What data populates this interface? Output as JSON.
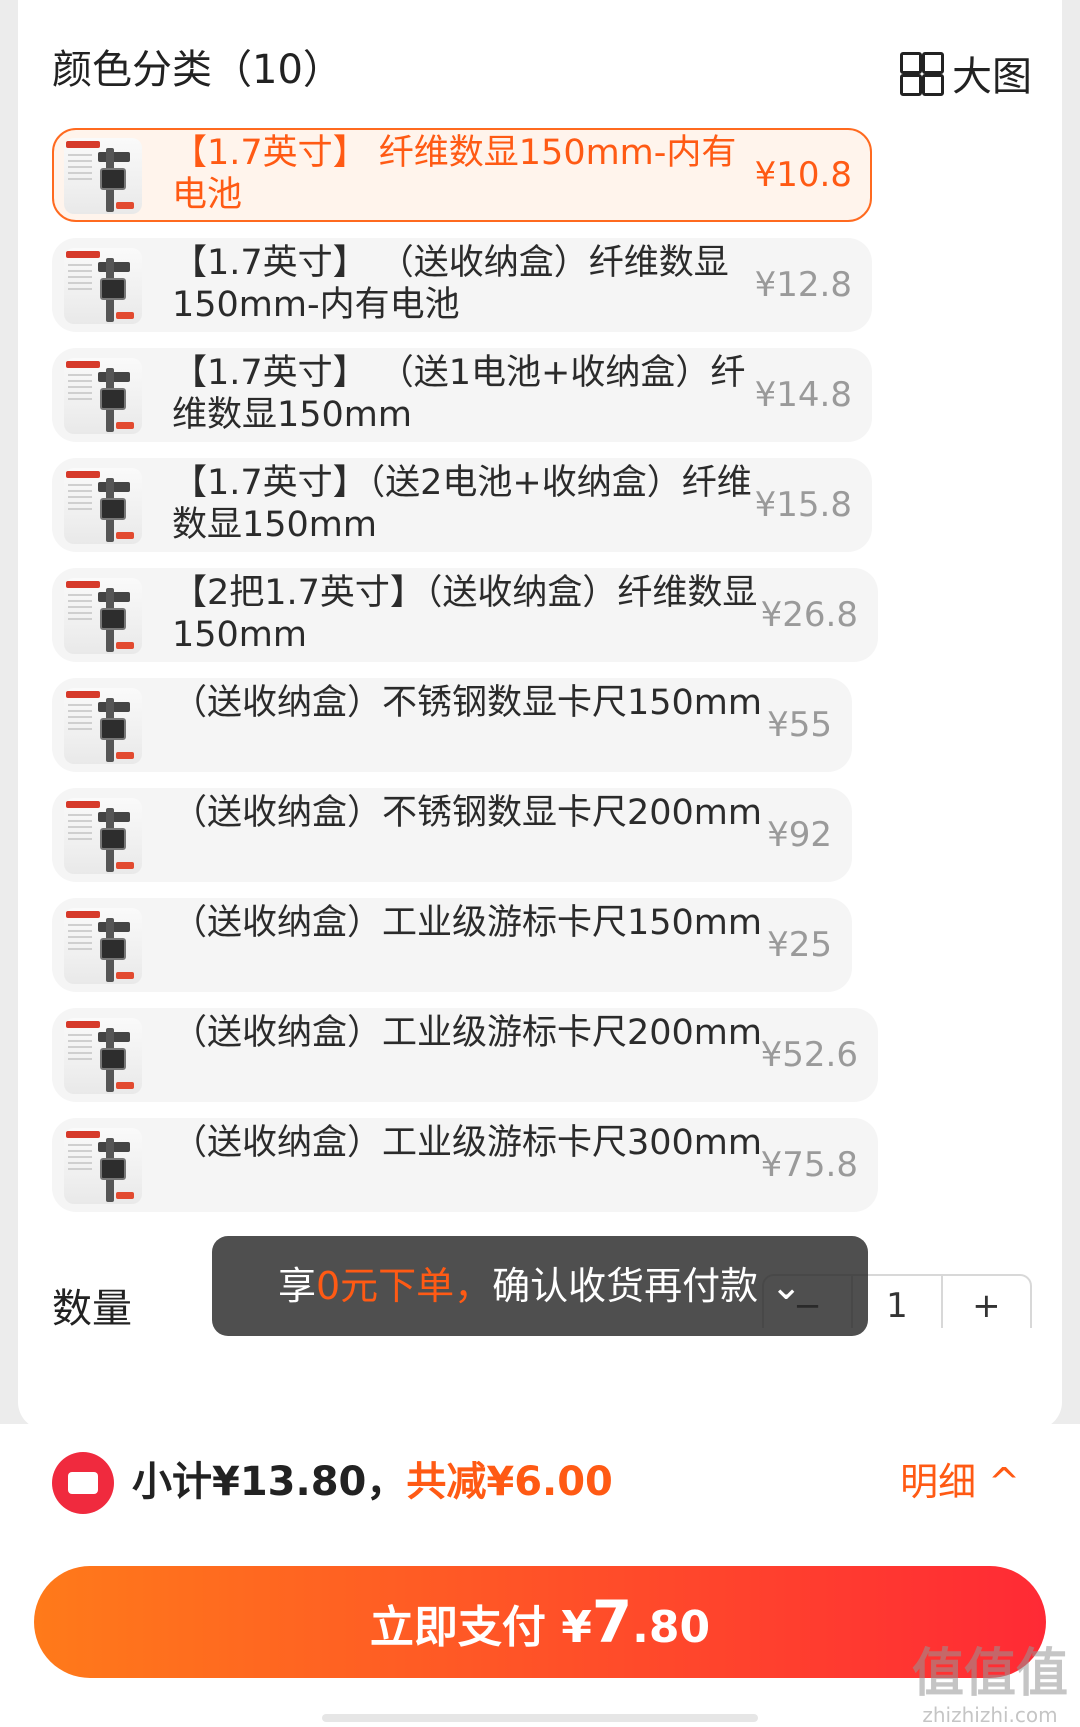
{
  "header": {
    "title": "颜色分类（10）",
    "bigview_label": "大图"
  },
  "variants": [
    {
      "name": "【1.7英寸】 纤维数显150mm-内有电池",
      "price": "¥10.8",
      "selected": true
    },
    {
      "name": "【1.7英寸】 （送收纳盒）纤维数显150mm-内有电池",
      "price": "¥12.8"
    },
    {
      "name": "【1.7英寸】 （送1电池+收纳盒）纤维数显150mm",
      "price": "¥14.8"
    },
    {
      "name": "【1.7英寸】（送2电池+收纳盒）纤维数显150mm",
      "price": "¥15.8"
    },
    {
      "name": "【2把1.7英寸】（送收纳盒）纤维数显150mm",
      "price": "¥26.8"
    },
    {
      "name": "（送收纳盒）不锈钢数显卡尺150mm",
      "price": "¥55"
    },
    {
      "name": "（送收纳盒）不锈钢数显卡尺200mm",
      "price": "¥92"
    },
    {
      "name": "（送收纳盒）工业级游标卡尺150mm",
      "price": "¥25"
    },
    {
      "name": "（送收纳盒）工业级游标卡尺200mm",
      "price": "¥52.6"
    },
    {
      "name": "（送收纳盒）工业级游标卡尺300mm",
      "price": "¥75.8"
    }
  ],
  "quantity": {
    "label": "数量",
    "minus": "−",
    "value": "1",
    "plus": "+"
  },
  "toast": {
    "prefix": "享",
    "highlight": "0元下单，",
    "rest": "确认收货再付款 ⌄"
  },
  "footer": {
    "subtotal": "小计¥13.80，",
    "discount": "共减¥6.00",
    "detail": "明细 ^",
    "pay_label": "立即支付 ¥",
    "pay_int": "7",
    "pay_dec": ".80"
  },
  "watermark": {
    "main": "值值值",
    "sub": "zhizhizhi.com"
  },
  "colors": {
    "accent": "#ff5a14",
    "pay_gradient_start": "#ff7a1a",
    "pay_gradient_end": "#ff2a35",
    "coupon_red": "#f02a3e"
  },
  "icons": {
    "bigview": "grid-icon",
    "coupon": "coupon-icon",
    "detail": "chevron-up-icon"
  }
}
